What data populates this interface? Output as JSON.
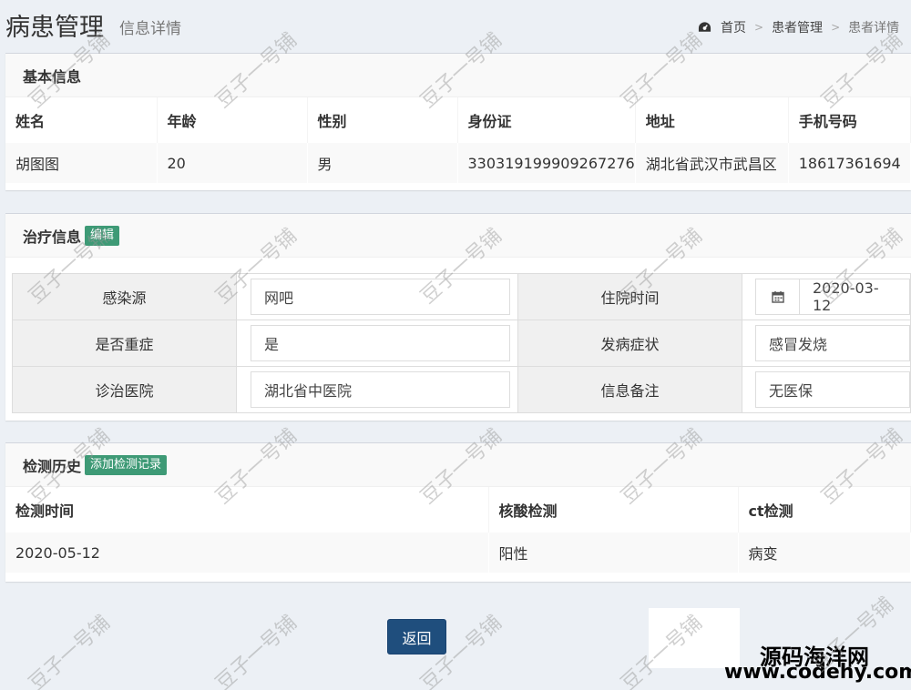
{
  "header": {
    "title": "病患管理",
    "subtitle": "信息详情",
    "breadcrumb": [
      "首页",
      "患者管理",
      "患者详情"
    ]
  },
  "basic": {
    "title": "基本信息",
    "columns": [
      "姓名",
      "年龄",
      "性别",
      "身份证",
      "地址",
      "手机号码"
    ],
    "row": [
      "胡图图",
      "20",
      "男",
      "330319199909267276",
      "湖北省武汉市武昌区",
      "18617361694"
    ]
  },
  "treatment": {
    "title": "治疗信息",
    "edit_label": "编辑",
    "rows": [
      {
        "label1": "感染源",
        "value1": "网吧",
        "label2": "住院时间",
        "value2": "2020-03-12"
      },
      {
        "label1": "是否重症",
        "value1": "是",
        "label2": "发病症状",
        "value2": "感冒发烧"
      },
      {
        "label1": "诊治医院",
        "value1": "湖北省中医院",
        "label2": "信息备注",
        "value2": "无医保"
      }
    ]
  },
  "tests": {
    "title": "检测历史",
    "add_label": "添加检测记录",
    "columns": [
      "检测时间",
      "核酸检测",
      "ct检测"
    ],
    "rows": [
      [
        "2020-05-12",
        "阳性",
        "病变"
      ]
    ]
  },
  "back_label": "返回",
  "watermark": "豆子一号铺",
  "site": {
    "name": "源码海洋网",
    "url": "www.codehy.com"
  },
  "colors": {
    "accent_green": "#3e9a76",
    "primary_button": "#1f4e7d",
    "background": "#ecf0f5"
  }
}
